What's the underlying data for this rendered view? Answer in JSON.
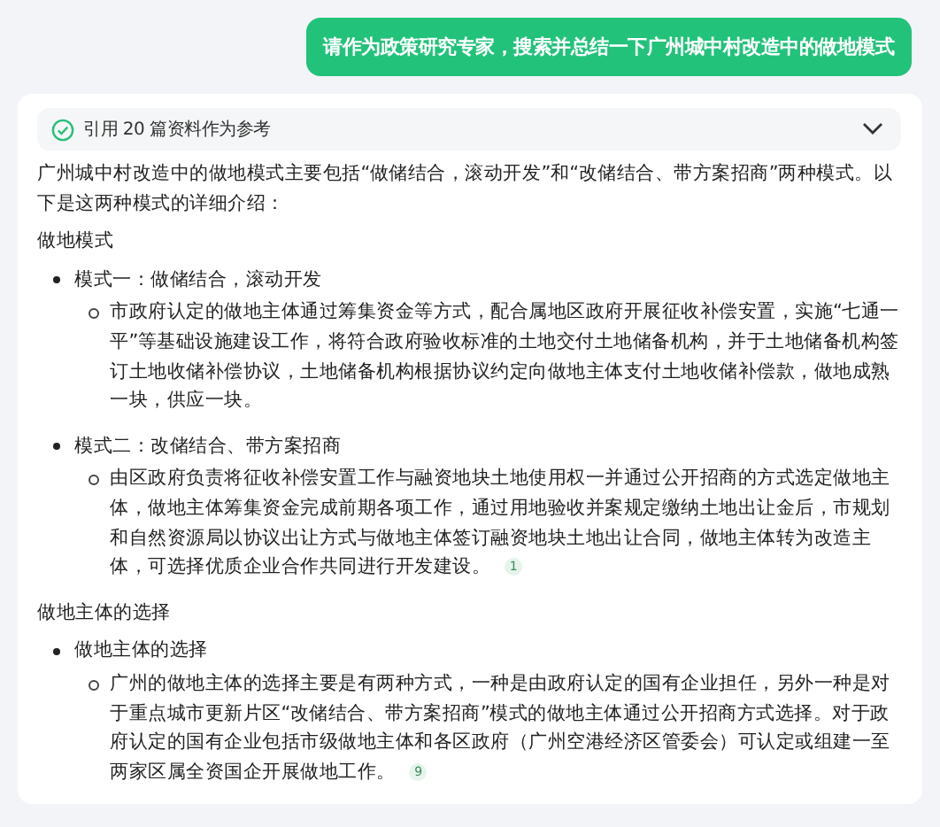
{
  "user_message": "请作为政策研究专家，搜索并总结一下广州城中村改造中的做地模式",
  "references": {
    "label": "引用 20 篇资料作为参考",
    "done": true,
    "expanded": false
  },
  "answer": {
    "intro": "广州城中村改造中的做地模式主要包括“做储结合，滚动开发”和“改储结合、带方案招商”两种模式。以下是这两种模式的详细介绍：",
    "sections": [
      {
        "heading": "做地模式",
        "items": [
          {
            "title": "模式一：做储结合，滚动开发",
            "details": [
              {
                "text": "市政府认定的做地主体通过筹集资金等方式，配合属地区政府开展征收补偿安置，实施“七通一平”等基础设施建设工作，将符合政府验收标准的土地交付土地储备机构，并于土地储备机构签订土地收储补偿协议，土地储备机构根据协议约定向做地主体支付土地收储补偿款，做地成熟一块，供应一块。"
              }
            ]
          },
          {
            "title": "模式二：改储结合、带方案招商",
            "details": [
              {
                "text": "由区政府负责将征收补偿安置工作与融资地块土地使用权一并通过公开招商的方式选定做地主体，做地主体筹集资金完成前期各项工作，通过用地验收并案规定缴纳土地出让金后，市规划和自然资源局以协议出让方式与做地主体签订融资地块土地出让合同，做地主体转为改造主体，可选择优质企业合作共同进行开发建设。",
                "citation": "1"
              }
            ]
          }
        ]
      },
      {
        "heading": "做地主体的选择",
        "items": [
          {
            "title": "做地主体的选择",
            "details": [
              {
                "text": "广州的做地主体的选择主要是有两种方式，一种是由政府认定的国有企业担任，另外一种是对于重点城市更新片区“改储结合、带方案招商”模式的做地主体通过公开招商方式选择。对于政府认定的国有企业包括市级做地主体和各区政府（广州空港经济区管委会）可认定或组建一至两家区属全资国企开展做地工作。",
                "citation": "9"
              }
            ]
          }
        ]
      }
    ]
  }
}
